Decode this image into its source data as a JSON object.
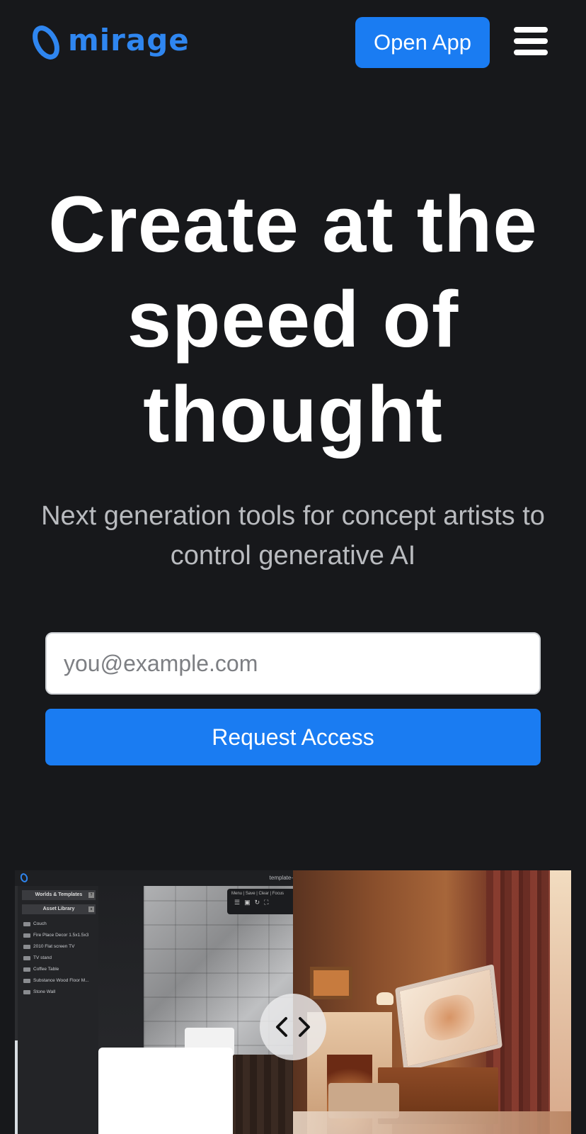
{
  "header": {
    "logo_text": "mirage",
    "open_app_label": "Open App",
    "menu_icon": "hamburger-menu-icon",
    "accent_color": "#1a7cf2"
  },
  "hero": {
    "title": "Create at the speed of thought",
    "subtitle": "Next generation tools for concept artists to control generative AI"
  },
  "signup": {
    "email_placeholder": "you@example.com",
    "email_value": "",
    "request_label": "Request Access"
  },
  "comparison": {
    "editor": {
      "document_title": "template-",
      "panel_worlds": "Worlds & Templates",
      "panel_assets": "Asset Library",
      "assets": [
        "Couch",
        "Fire Place Decor 1.5x1.5x3",
        "2010 Flat screen TV",
        "TV stand",
        "Coffee Table",
        "Substance Wood Floor M...",
        "Stone Wall"
      ],
      "toolbar_text": "Menu | Save | Clear | Focus"
    },
    "slider_icon": "chevron-left-right-icon"
  }
}
